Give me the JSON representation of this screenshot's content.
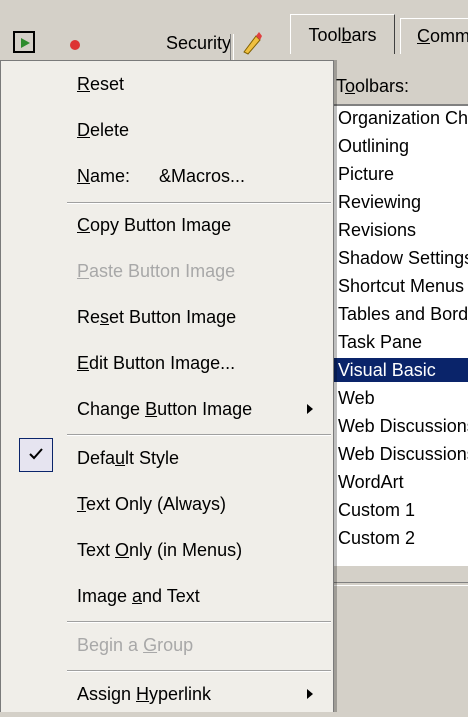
{
  "colors": {
    "menu_bg": "#f0eee9",
    "selection": "#0a246a",
    "disabled_text": "#a8a8a8",
    "dialog_bg": "#d4d0c8"
  },
  "toolbar_strip": {
    "security_label": "Security"
  },
  "dialog": {
    "tabs": [
      {
        "label": "Toolbars"
      },
      {
        "label": "Commands"
      }
    ],
    "toolbars_heading": "Toolbars:",
    "list_items": [
      {
        "label": "Organization Chart"
      },
      {
        "label": "Outlining"
      },
      {
        "label": "Picture"
      },
      {
        "label": "Reviewing"
      },
      {
        "label": "Revisions"
      },
      {
        "label": "Shadow Settings"
      },
      {
        "label": "Shortcut Menus"
      },
      {
        "label": "Tables and Borders"
      },
      {
        "label": "Task Pane"
      },
      {
        "label": "Visual Basic",
        "selected": true
      },
      {
        "label": "Web"
      },
      {
        "label": "Web Discussions"
      },
      {
        "label": "Web Discussions"
      },
      {
        "label": "WordArt"
      },
      {
        "label": "Custom 1"
      },
      {
        "label": "Custom 2"
      }
    ]
  },
  "menu": {
    "items": [
      {
        "key": "reset",
        "label": "Reset"
      },
      {
        "key": "delete",
        "label": "Delete"
      },
      {
        "key": "name",
        "label": "Name:",
        "value": "&Macros..."
      },
      {
        "key": "copy-button-image",
        "label": "Copy Button Image"
      },
      {
        "key": "paste-button-image",
        "label": "Paste Button Image",
        "disabled": true
      },
      {
        "key": "reset-button-image",
        "label": "Reset Button Image"
      },
      {
        "key": "edit-button-image",
        "label": "Edit Button Image..."
      },
      {
        "key": "change-button-image",
        "label": "Change Button Image",
        "submenu": true
      },
      {
        "key": "default-style",
        "label": "Default Style",
        "checked": true
      },
      {
        "key": "text-only-always",
        "label": "Text Only (Always)"
      },
      {
        "key": "text-only-menus",
        "label": "Text Only (in Menus)"
      },
      {
        "key": "image-and-text",
        "label": "Image and Text"
      },
      {
        "key": "begin-a-group",
        "label": "Begin a Group",
        "disabled": true
      },
      {
        "key": "assign-hyperlink",
        "label": "Assign Hyperlink",
        "submenu": true
      }
    ]
  }
}
